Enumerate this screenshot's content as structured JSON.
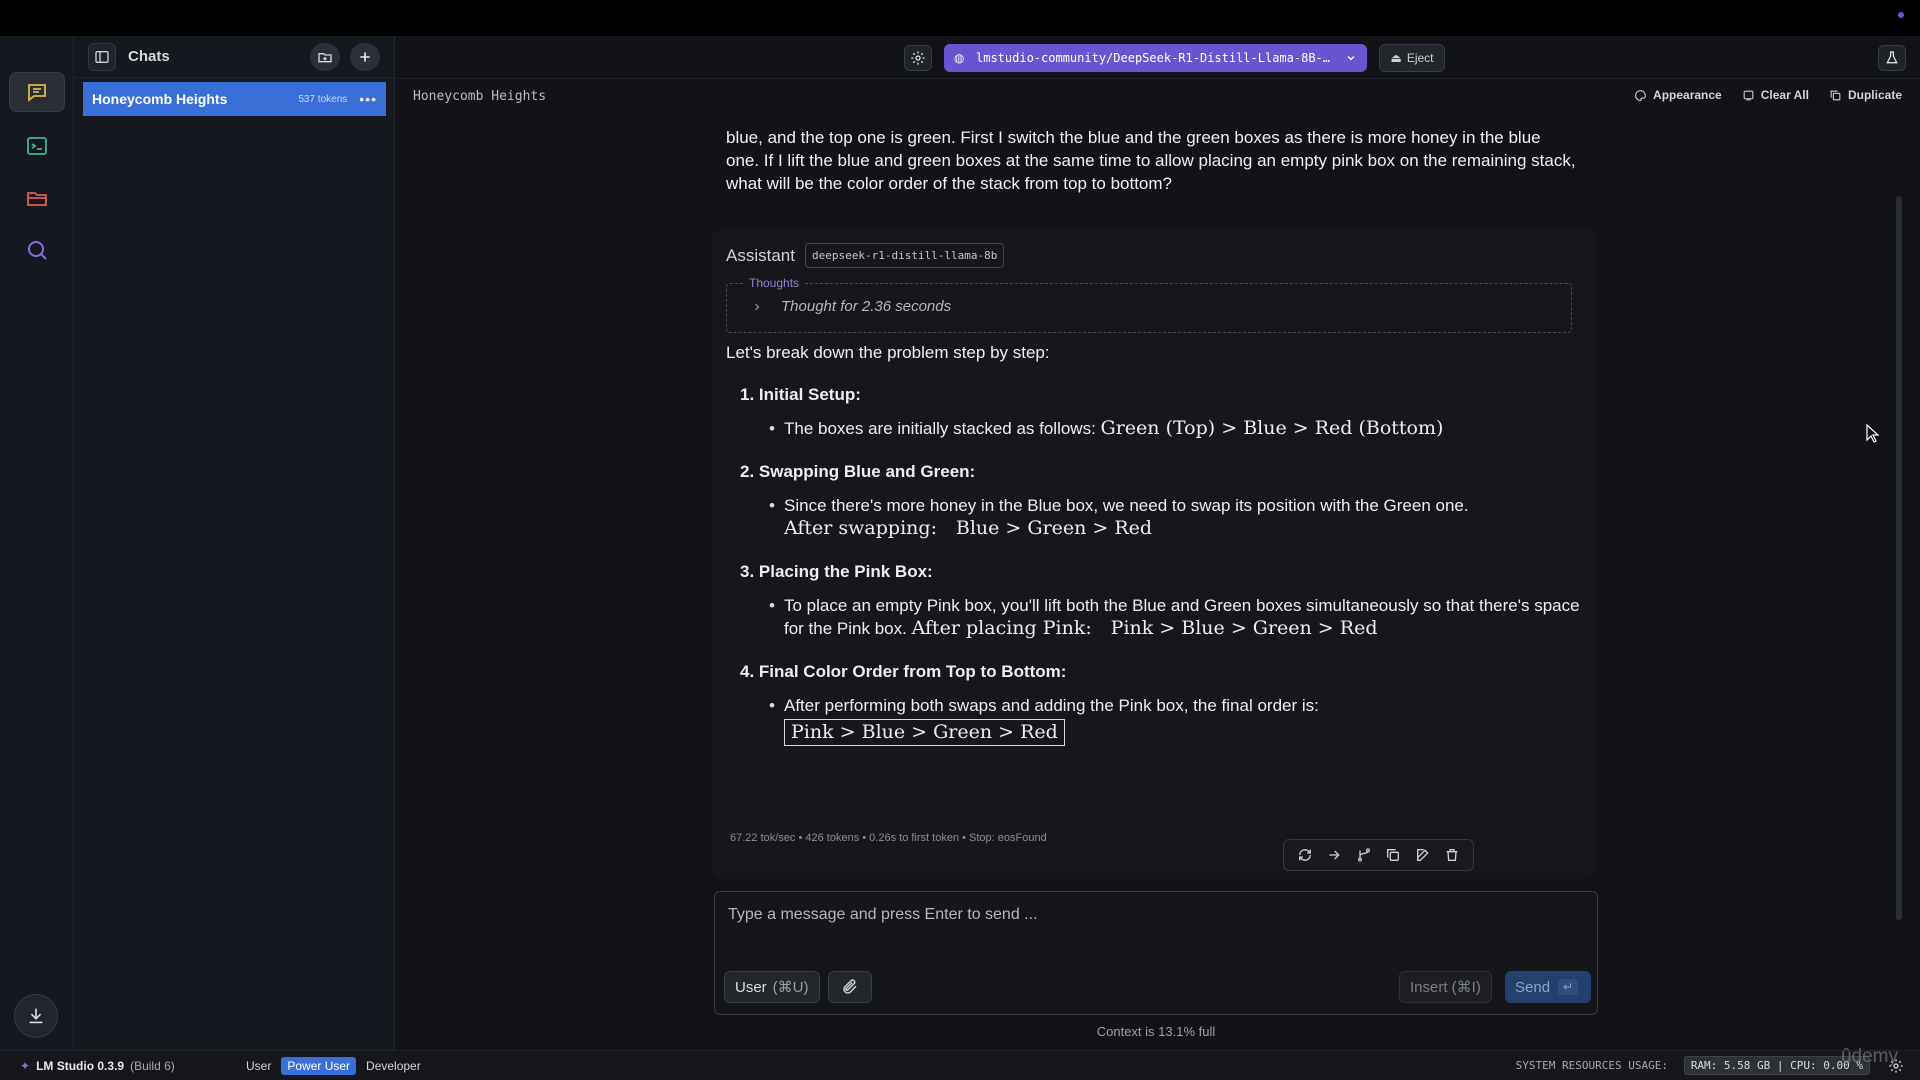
{
  "sidebar": {
    "title": "Chats",
    "chats": [
      {
        "name": "Honeycomb Heights",
        "tokens": "537 tokens"
      }
    ]
  },
  "toolbar": {
    "model": "lmstudio-community/DeepSeek-R1-Distill-Llama-8B-…",
    "eject_label": "Eject"
  },
  "subbar": {
    "chat_title": "Honeycomb Heights",
    "appearance": "Appearance",
    "clear_all": "Clear All",
    "duplicate": "Duplicate"
  },
  "user_message": "blue, and the top one is green. First I switch the blue and the green boxes as there is more honey in the blue one. If I lift the blue and green boxes at the same time to allow placing an empty pink box on the remaining stack, what will be the color order of the stack from top to bottom?",
  "assistant": {
    "role": "Assistant",
    "model_tag": "deepseek-r1-distill-llama-8b",
    "thoughts_legend": "Thoughts",
    "thought_summary": "Thought for 2.36 seconds",
    "intro": "Let's break down the problem step by step:",
    "steps": [
      {
        "title": "1. Initial Setup:",
        "text": "The boxes are initially stacked as follows: ",
        "math": "Green (Top) > Blue > Red (Bottom)"
      },
      {
        "title": "2. Swapping Blue and Green:",
        "text": "Since there's more honey in the Blue box, we need to swap its position with the Green one.",
        "math_label": "After swapping:",
        "math": "Blue > Green > Red"
      },
      {
        "title": "3. Placing the Pink Box:",
        "text": "To place an empty Pink box, you'll lift both the Blue and Green boxes simultaneously so that there's space for the Pink box. ",
        "math_label": "After placing Pink:",
        "math": "Pink > Blue > Green > Red"
      },
      {
        "title": "4. Final Color Order from Top to Bottom:",
        "text": "After performing both swaps and adding the Pink box, the final order is:",
        "math": "Pink > Blue > Green > Red"
      }
    ],
    "stats": "67.22 tok/sec  •  426 tokens  •  0.26s to first token  •  Stop: eosFound"
  },
  "composer": {
    "placeholder": "Type a message and press Enter to send ...",
    "role_label": "User",
    "role_shortcut": "(⌘U)",
    "insert_label": "Insert (⌘I)",
    "send_label": "Send",
    "send_key": "↵",
    "context": "Context is 13.1% full"
  },
  "statusbar": {
    "app_name": "LM Studio 0.3.9",
    "build": "(Build 6)",
    "modes": [
      "User",
      "Power User",
      "Developer"
    ],
    "active_mode": "Power User",
    "resources_label": "SYSTEM RESOURCES USAGE:",
    "resources_value": "RAM: 5.58 GB  |  CPU: 0.00 %"
  },
  "watermark": "ûdemy",
  "colors": {
    "accent_blue": "#3a6fd8",
    "model_purple": "#6a55d0",
    "background": "#111318"
  },
  "icons": [
    "sidebar-toggle-icon",
    "new-folder-icon",
    "plus-icon",
    "chat-icon",
    "terminal-icon",
    "folder-icon",
    "search-icon",
    "download-icon",
    "gear-icon",
    "flask-icon",
    "palette-icon",
    "clear-icon",
    "duplicate-icon",
    "regenerate-icon",
    "continue-icon",
    "branch-icon",
    "copy-icon",
    "edit-icon",
    "trash-icon",
    "paperclip-icon",
    "chevron-right-icon",
    "chevron-down-icon",
    "eject-icon"
  ]
}
